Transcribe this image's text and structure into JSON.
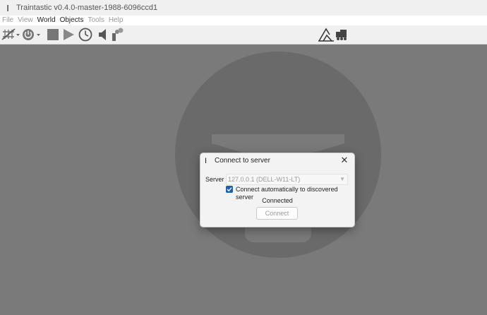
{
  "window": {
    "title": "Traintastic v0.4.0-master-1988-6096ccd1",
    "app_icon": "I"
  },
  "menu": [
    {
      "label": "File",
      "enabled": false
    },
    {
      "label": "View",
      "enabled": false
    },
    {
      "label": "World",
      "enabled": true
    },
    {
      "label": "Objects",
      "enabled": true
    },
    {
      "label": "Tools",
      "enabled": false
    },
    {
      "label": "Help",
      "enabled": false
    }
  ],
  "toolbar": {
    "icons": [
      "track-power-icon",
      "power-icon",
      "stop-icon",
      "run-icon",
      "clock-icon",
      "mute-icon",
      "smoke-icon",
      "edit-world-icon",
      "train-icon"
    ]
  },
  "dialog": {
    "title": "Connect to server",
    "close_glyph": "✕",
    "server_label": "Server",
    "server_value": "127.0.0.1 (DELL-W11-LT)",
    "auto_connect_label": "Connect automatically to discovered server",
    "auto_connect_checked": true,
    "status": "Connected",
    "connect_button": "Connect"
  },
  "colors": {
    "workspace": "#7a7a7a",
    "checkbox_accent": "#1f5fa8"
  }
}
